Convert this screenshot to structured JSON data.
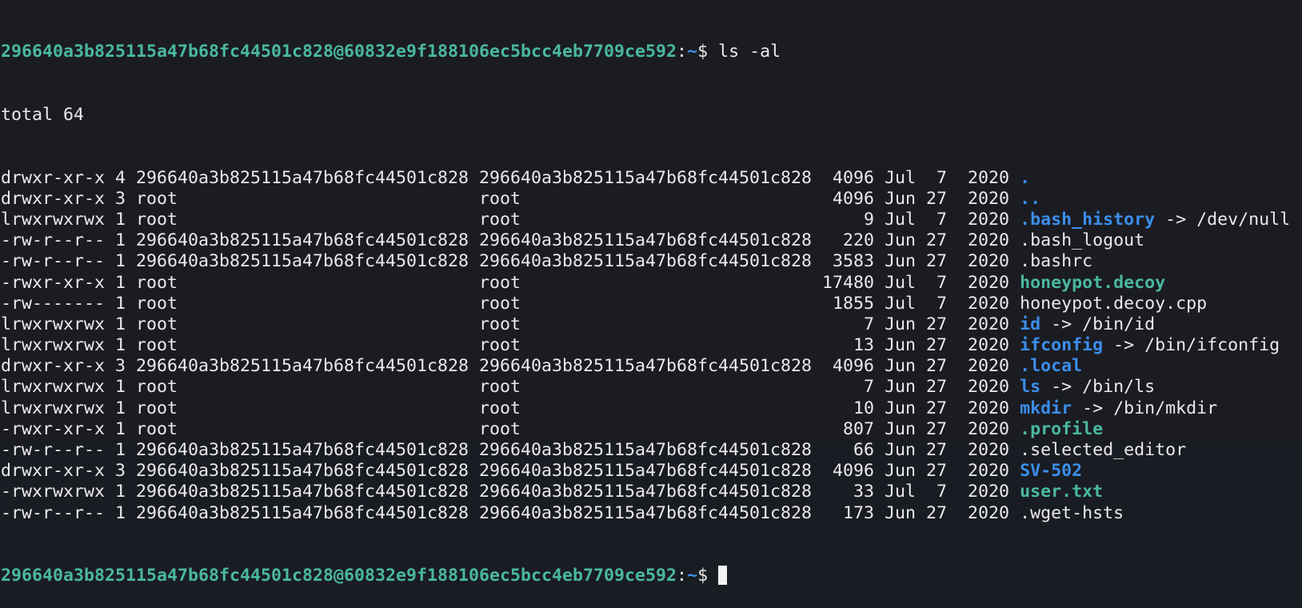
{
  "prompt": {
    "user_host": "296640a3b825115a47b68fc44501c828@60832e9f188106ec5bcc4eb7709ce592",
    "sep": ":",
    "path": "~",
    "symbol": "$ "
  },
  "command": "ls -al",
  "total": "total 64",
  "entries": [
    {
      "prefix": "drwxr-xr-x 4 296640a3b825115a47b68fc44501c828 296640a3b825115a47b68fc44501c828  4096 Jul  7  2020 ",
      "name": ".",
      "kind": "dir",
      "target": ""
    },
    {
      "prefix": "drwxr-xr-x 3 root                             root                              4096 Jun 27  2020 ",
      "name": "..",
      "kind": "dir",
      "target": ""
    },
    {
      "prefix": "lrwxrwxrwx 1 root                             root                                 9 Jul  7  2020 ",
      "name": ".bash_history",
      "kind": "link",
      "target": " -> /dev/null"
    },
    {
      "prefix": "-rw-r--r-- 1 296640a3b825115a47b68fc44501c828 296640a3b825115a47b68fc44501c828   220 Jun 27  2020 ",
      "name": ".bash_logout",
      "kind": "plain",
      "target": ""
    },
    {
      "prefix": "-rw-r--r-- 1 296640a3b825115a47b68fc44501c828 296640a3b825115a47b68fc44501c828  3583 Jun 27  2020 ",
      "name": ".bashrc",
      "kind": "plain",
      "target": ""
    },
    {
      "prefix": "-rwxr-xr-x 1 root                             root                             17480 Jul  7  2020 ",
      "name": "honeypot.decoy",
      "kind": "exe",
      "target": ""
    },
    {
      "prefix": "-rw------- 1 root                             root                              1855 Jul  7  2020 ",
      "name": "honeypot.decoy.cpp",
      "kind": "plain",
      "target": ""
    },
    {
      "prefix": "lrwxrwxrwx 1 root                             root                                 7 Jun 27  2020 ",
      "name": "id",
      "kind": "link",
      "target": " -> /bin/id"
    },
    {
      "prefix": "lrwxrwxrwx 1 root                             root                                13 Jun 27  2020 ",
      "name": "ifconfig",
      "kind": "link",
      "target": " -> /bin/ifconfig"
    },
    {
      "prefix": "drwxr-xr-x 3 296640a3b825115a47b68fc44501c828 296640a3b825115a47b68fc44501c828  4096 Jun 27  2020 ",
      "name": ".local",
      "kind": "dir",
      "target": ""
    },
    {
      "prefix": "lrwxrwxrwx 1 root                             root                                 7 Jun 27  2020 ",
      "name": "ls",
      "kind": "link",
      "target": " -> /bin/ls"
    },
    {
      "prefix": "lrwxrwxrwx 1 root                             root                                10 Jun 27  2020 ",
      "name": "mkdir",
      "kind": "link",
      "target": " -> /bin/mkdir"
    },
    {
      "prefix": "-rwxr-xr-x 1 root                             root                               807 Jun 27  2020 ",
      "name": ".profile",
      "kind": "exe",
      "target": ""
    },
    {
      "prefix": "-rw-r--r-- 1 296640a3b825115a47b68fc44501c828 296640a3b825115a47b68fc44501c828    66 Jun 27  2020 ",
      "name": ".selected_editor",
      "kind": "plain",
      "target": ""
    },
    {
      "prefix": "drwxr-xr-x 3 296640a3b825115a47b68fc44501c828 296640a3b825115a47b68fc44501c828  4096 Jun 27  2020 ",
      "name": "SV-502",
      "kind": "dir",
      "target": ""
    },
    {
      "prefix": "-rwxrwxrwx 1 296640a3b825115a47b68fc44501c828 296640a3b825115a47b68fc44501c828    33 Jul  7  2020 ",
      "name": "user.txt",
      "kind": "exe",
      "target": ""
    },
    {
      "prefix": "-rw-r--r-- 1 296640a3b825115a47b68fc44501c828 296640a3b825115a47b68fc44501c828   173 Jun 27  2020 ",
      "name": ".wget-hsts",
      "kind": "plain",
      "target": ""
    }
  ],
  "colors": {
    "background": "#1b1c22",
    "foreground": "#eaeaea",
    "prompt_user": "#4ab8a0",
    "prompt_path": "#3b8eea",
    "directory": "#3b8eea",
    "symlink": "#3b8eea",
    "executable": "#4ab8a0"
  }
}
